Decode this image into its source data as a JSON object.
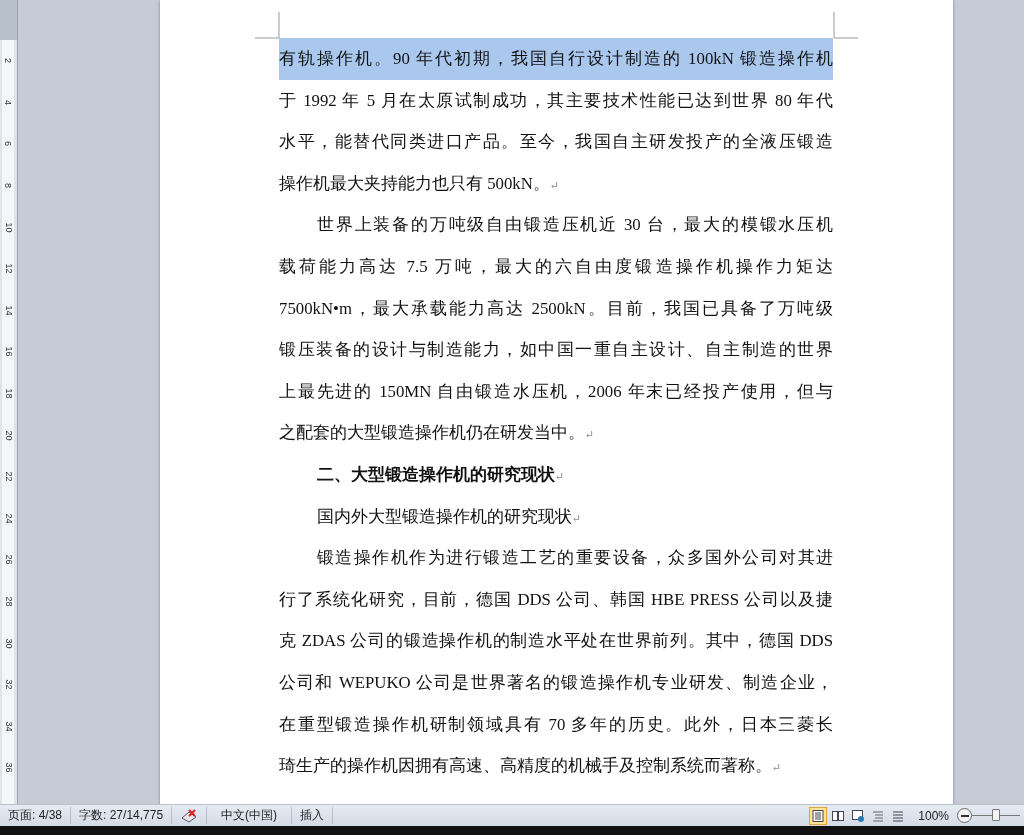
{
  "ruler": {
    "marks": [
      "2",
      "4",
      "6",
      "8",
      "10",
      "12",
      "14",
      "16",
      "18",
      "20",
      "22",
      "24",
      "26",
      "28",
      "30",
      "32",
      "34",
      "36"
    ]
  },
  "document": {
    "paragraphs": [
      {
        "kind": "continuation",
        "end_mark": "↵",
        "lines": [
          {
            "text": "有轨操作机。90 年代初期，我国自行设计制造的 100kN 锻造操作机",
            "selected": true
          },
          {
            "text": "于 1992 年 5 月在太原试制成功，其主要技术性能已达到世界 80 年代",
            "selected": false
          },
          {
            "text": "水平，能替代同类进口产品。至今，我国自主研发投产的全液压锻造",
            "selected": false
          },
          {
            "text": "操作机最大夹持能力也只有 500kN。",
            "selected": false
          }
        ]
      },
      {
        "kind": "body",
        "end_mark": "↵",
        "lines": [
          {
            "text": "世界上装备的万吨级自由锻造压机近 30 台，最大的模锻水压机",
            "selected": false
          },
          {
            "text": "载荷能力高达 7.5 万吨，最大的六自由度锻造操作机操作力矩达",
            "selected": false
          },
          {
            "text": "7500kN•m，最大承载能力高达 2500kN。目前，我国已具备了万吨级",
            "selected": false
          },
          {
            "text": "锻压装备的设计与制造能力，如中国一重自主设计、自主制造的世界",
            "selected": false
          },
          {
            "text": "上最先进的 150MN 自由锻造水压机，2006 年末已经投产使用，但与",
            "selected": false
          },
          {
            "text": "之配套的大型锻造操作机仍在研发当中。",
            "selected": false
          }
        ]
      },
      {
        "kind": "heading",
        "end_mark": "↵",
        "lines": [
          {
            "text": "二、大型锻造操作机的研究现状",
            "selected": false
          }
        ]
      },
      {
        "kind": "body",
        "end_mark": "↵",
        "lines": [
          {
            "text": "国内外大型锻造操作机的研究现状",
            "selected": false
          }
        ]
      },
      {
        "kind": "body",
        "end_mark": "↵",
        "lines": [
          {
            "text": "锻造操作机作为进行锻造工艺的重要设备，众多国外公司对其进",
            "selected": false
          },
          {
            "text": "行了系统化研究，目前，德国 DDS 公司、韩国 HBE PRESS 公司以及捷",
            "selected": false
          },
          {
            "text": "克 ZDAS 公司的锻造操作机的制造水平处在世界前列。其中，德国 DDS",
            "selected": false
          },
          {
            "text": "公司和 WEPUKO 公司是世界著名的锻造操作机专业研发、制造企业，",
            "selected": false
          },
          {
            "text": "在重型锻造操作机研制领域具有 70 多年的历史。此外，日本三菱长",
            "selected": false
          },
          {
            "text": "琦生产的操作机因拥有高速、高精度的机械手及控制系统而著称。",
            "selected": false
          }
        ]
      }
    ]
  },
  "status_bar": {
    "page": "页面: 4/38",
    "words": "字数: 27/14,775",
    "language": "中文(中国)",
    "mode": "插入",
    "views": [
      {
        "kind": "print",
        "selected": true
      },
      {
        "kind": "reading",
        "selected": false
      },
      {
        "kind": "web",
        "selected": false
      },
      {
        "kind": "outline",
        "selected": false
      },
      {
        "kind": "draft",
        "selected": false
      }
    ],
    "zoom": "100%",
    "zoom_slider": {
      "level": 0.5
    }
  }
}
